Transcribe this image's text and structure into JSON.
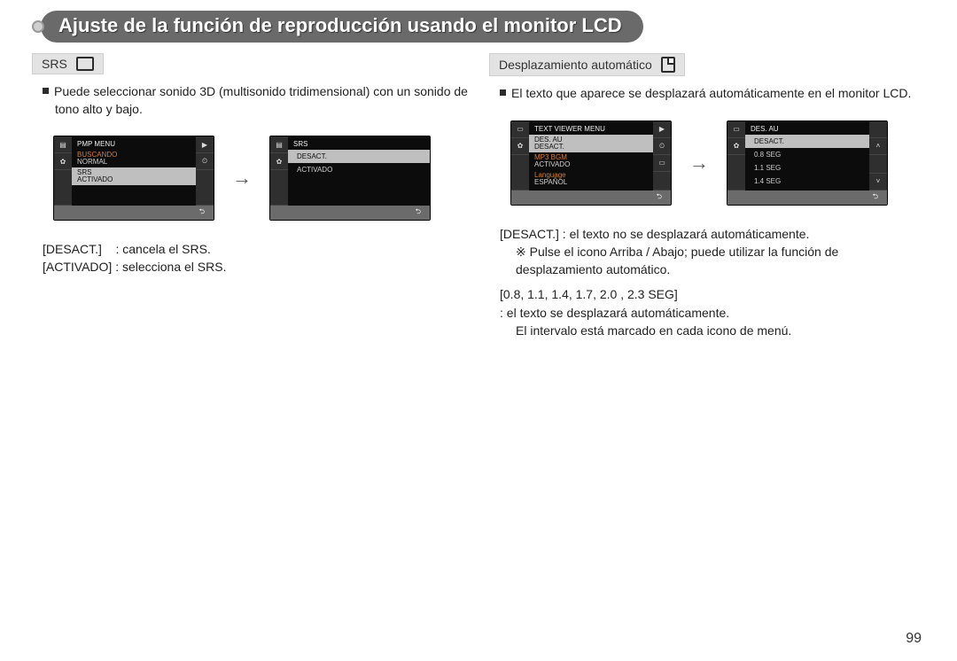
{
  "page": {
    "number": "99"
  },
  "title": "Ajuste de la función de reproducción usando el monitor LCD",
  "left": {
    "heading": "SRS",
    "body": "Puede seleccionar sonido 3D (multisonido tridimensional) con un sonido de tono alto y bajo.",
    "defs": {
      "off_label": "[DESACT.]",
      "off_text": ": cancela el SRS.",
      "on_label": "[ACTIVADO]",
      "on_text": ": selecciona el SRS."
    },
    "shot1": {
      "title": "PMP MENU",
      "rows": [
        {
          "lbl": "BUSCANDO",
          "val": "NORMAL",
          "sel": false
        },
        {
          "lbl": "SRS",
          "val": "ACTIVADO",
          "sel": true
        }
      ]
    },
    "shot2": {
      "title": "SRS",
      "options": [
        {
          "text": "DESACT.",
          "sel": true
        },
        {
          "text": "ACTIVADO",
          "sel": false
        }
      ]
    }
  },
  "right": {
    "heading": "Desplazamiento automático",
    "body": "El texto que aparece se desplazará automáticamente en el monitor LCD.",
    "defs": {
      "off_label": "[DESACT.]",
      "off_text": ": el texto no se desplazará automáticamente.",
      "note_mark": "※",
      "note_text": "Pulse el icono Arriba / Abajo; puede utilizar la función de desplazamiento automático.",
      "range_label": "[0.8, 1.1, 1.4, 1.7, 2.0 , 2.3 SEG]",
      "range_text1": ": el texto se desplazará automáticamente.",
      "range_text2": "El intervalo está marcado en cada icono de menú."
    },
    "shot1": {
      "title": "TEXT VIEWER MENU",
      "rows": [
        {
          "lbl": "DES. AU",
          "val": "DESACT.",
          "sel": true
        },
        {
          "lbl": "MP3 BGM",
          "val": "ACTIVADO",
          "sel": false
        },
        {
          "lbl": "Language",
          "val": "ESPAÑOL",
          "sel": false
        }
      ]
    },
    "shot2": {
      "title": "DES. AU",
      "options": [
        {
          "text": "DESACT.",
          "sel": true
        },
        {
          "text": "0.8 SEG",
          "sel": false
        },
        {
          "text": "1.1 SEG",
          "sel": false
        },
        {
          "text": "1.4 SEG",
          "sel": false
        }
      ]
    }
  },
  "icons": {
    "film": "▤",
    "gear": "✿",
    "play": "▶",
    "time": "⏲",
    "page": "▭",
    "up": "˄",
    "down": "˅",
    "back": "⮌"
  }
}
